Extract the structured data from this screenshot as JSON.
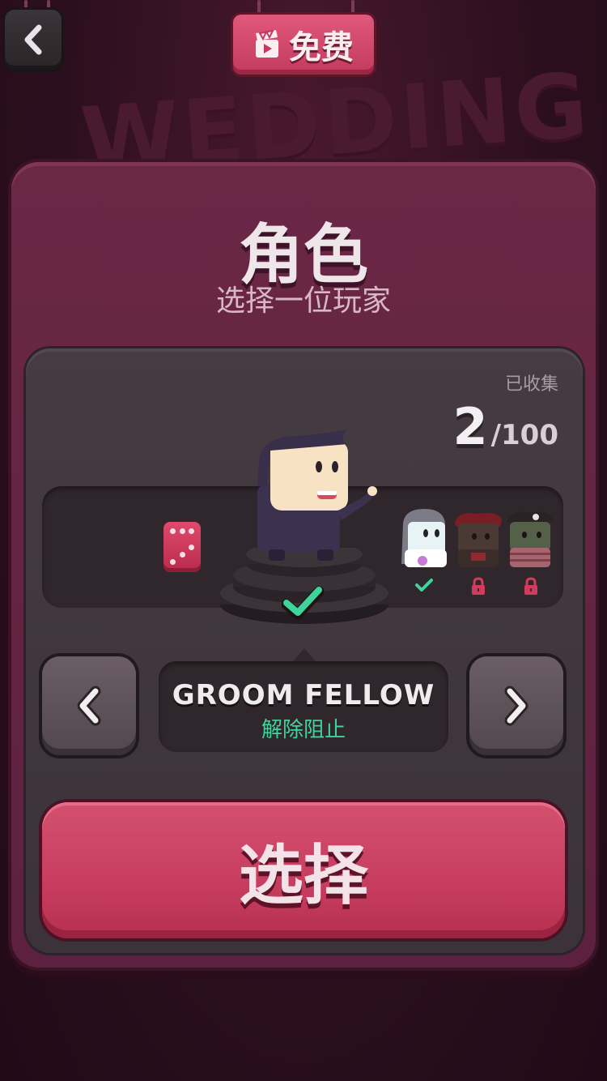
{
  "top_bar": {
    "back_icon": "chevron-left-icon",
    "free_icon": "clapperboard-icon",
    "free_label": "免费"
  },
  "background_text": "WEDDING",
  "header": {
    "title": "角色",
    "subtitle": "选择一位玩家"
  },
  "collection": {
    "label": "已收集",
    "count": "2",
    "total": "/100"
  },
  "carousel": {
    "random_icon": "dice-icon",
    "characters": [
      {
        "name": "groom",
        "status": "unlocked"
      },
      {
        "name": "bride",
        "status": "unlocked"
      },
      {
        "name": "pirate",
        "status": "locked"
      },
      {
        "name": "zombie-pirate",
        "status": "locked"
      }
    ]
  },
  "selected_character": {
    "name": "GROOM FELLOW",
    "status": "解除阻止"
  },
  "select_button": {
    "label": "选择"
  },
  "colors": {
    "accent": "#c73d5f",
    "unlocked": "#3fd49c",
    "locked": "#d43a5e"
  }
}
